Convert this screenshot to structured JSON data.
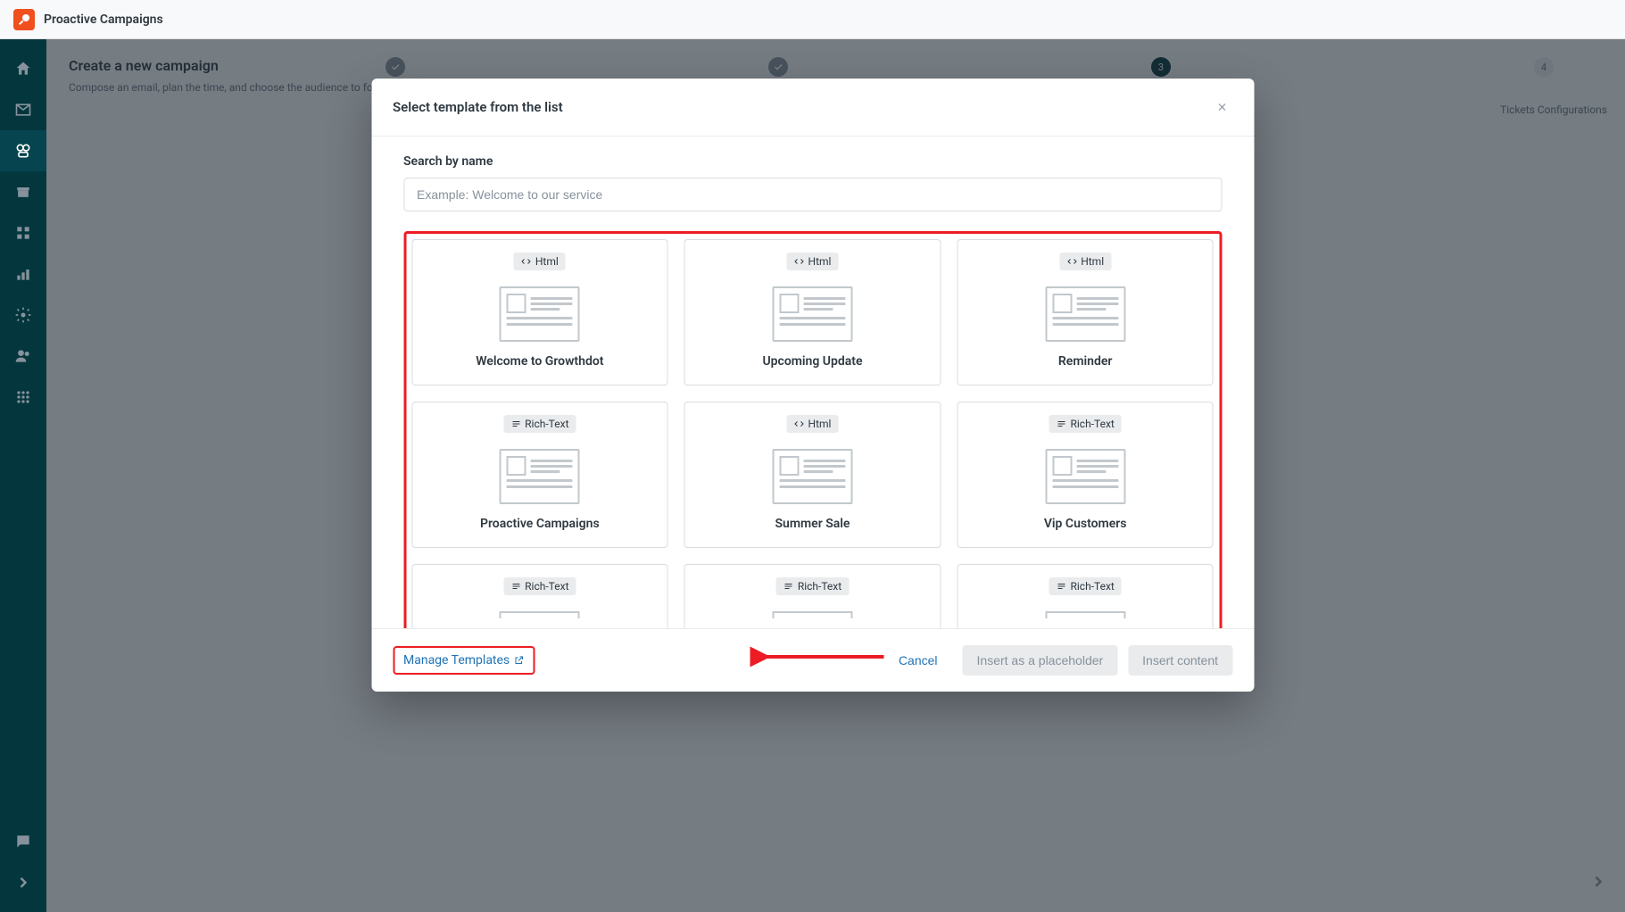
{
  "topbar": {
    "title": "Proactive Campaigns"
  },
  "bg": {
    "title": "Create a new campaign",
    "desc": "Compose an email, plan the time, and choose the audience to follow-up with.",
    "step3": "3",
    "step4": "4",
    "step4_label": "Tickets Configurations"
  },
  "modal": {
    "title": "Select template from the list",
    "search_label": "Search by name",
    "search_placeholder": "Example: Welcome to our service",
    "templates": [
      {
        "type": "Html",
        "type_kind": "html",
        "name": "Welcome to Growthdot"
      },
      {
        "type": "Html",
        "type_kind": "html",
        "name": "Upcoming Update"
      },
      {
        "type": "Html",
        "type_kind": "html",
        "name": "Reminder"
      },
      {
        "type": "Rich-Text",
        "type_kind": "rich",
        "name": "Proactive Campaigns"
      },
      {
        "type": "Html",
        "type_kind": "html",
        "name": "Summer Sale"
      },
      {
        "type": "Rich-Text",
        "type_kind": "rich",
        "name": "Vip Customers"
      },
      {
        "type": "Rich-Text",
        "type_kind": "rich",
        "name": ""
      },
      {
        "type": "Rich-Text",
        "type_kind": "rich",
        "name": ""
      },
      {
        "type": "Rich-Text",
        "type_kind": "rich",
        "name": ""
      }
    ],
    "manage_link": "Manage Templates",
    "cancel": "Cancel",
    "insert_placeholder": "Insert as a placeholder",
    "insert_content": "Insert content"
  }
}
